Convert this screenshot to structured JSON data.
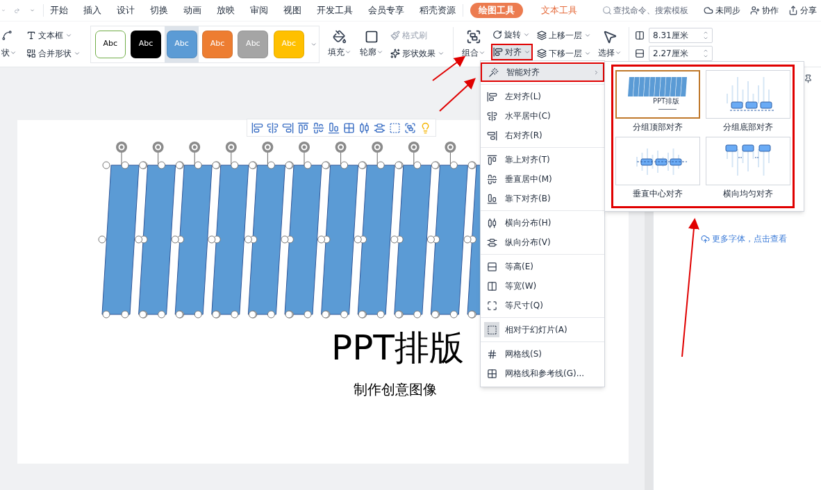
{
  "menu_tabs": [
    {
      "label": "开始",
      "selected": false
    },
    {
      "label": "插入",
      "selected": false
    },
    {
      "label": "设计",
      "selected": false
    },
    {
      "label": "切换",
      "selected": false
    },
    {
      "label": "动画",
      "selected": false
    },
    {
      "label": "放映",
      "selected": false
    },
    {
      "label": "审阅",
      "selected": false
    },
    {
      "label": "视图",
      "selected": false
    },
    {
      "label": "开发工具",
      "selected": false
    },
    {
      "label": "会员专享",
      "selected": false
    },
    {
      "label": "稻壳资源",
      "selected": false
    }
  ],
  "context_tabs": [
    {
      "label": "绘图工具",
      "selected": true
    },
    {
      "label": "文本工具",
      "selected": false
    }
  ],
  "search": {
    "placeholder": "查找命令、搜索模板"
  },
  "top_actions": [
    "未同步",
    "协作",
    "分享"
  ],
  "ribbon": {
    "shape_partial": "状",
    "textbox": "文本框",
    "merge_shapes": "合并形状",
    "style_presets": [
      {
        "label": "Abc",
        "color": "#ffffff",
        "selected": false
      },
      {
        "label": "Abc",
        "color": "#000000",
        "selected": false
      },
      {
        "label": "Abc",
        "color": "#5b9bd5",
        "selected": true
      },
      {
        "label": "Abc",
        "color": "#ed7d31",
        "selected": false
      },
      {
        "label": "Abc",
        "color": "#a5a5a5",
        "selected": false
      },
      {
        "label": "Abc",
        "color": "#ffc000",
        "selected": false
      }
    ],
    "fill": "填充",
    "outline": "轮廓",
    "format_painter": {
      "label": "格式刷",
      "disabled": true
    },
    "shape_effects": "形状效果",
    "group": "组合",
    "rotate": "旋转",
    "align": "对齐",
    "bring_forward": "上移一层",
    "send_backward": "下移一层",
    "select": "选择",
    "height": "8.31厘米",
    "width": "2.27厘米"
  },
  "slide": {
    "title": "PPT排版",
    "subtitle": "制作创意图像"
  },
  "align_menu": {
    "groups": [
      [
        {
          "label": "智能对齐",
          "kind": "submenu",
          "selected": true
        }
      ],
      [
        {
          "label": "左对齐(L)",
          "kind": "command",
          "selected": false
        },
        {
          "label": "水平居中(C)",
          "kind": "command",
          "selected": false
        },
        {
          "label": "右对齐(R)",
          "kind": "command",
          "selected": false
        }
      ],
      [
        {
          "label": "靠上对齐(T)",
          "kind": "command",
          "selected": false
        },
        {
          "label": "垂直居中(M)",
          "kind": "command",
          "selected": false
        },
        {
          "label": "靠下对齐(B)",
          "kind": "command",
          "selected": false
        }
      ],
      [
        {
          "label": "横向分布(H)",
          "kind": "command",
          "selected": false
        },
        {
          "label": "纵向分布(V)",
          "kind": "command",
          "selected": false
        }
      ],
      [
        {
          "label": "等高(E)",
          "kind": "command",
          "selected": false
        },
        {
          "label": "等宽(W)",
          "kind": "command",
          "selected": false
        },
        {
          "label": "等尺寸(Q)",
          "kind": "command",
          "selected": false
        }
      ],
      [
        {
          "label": "相对于幻灯片(A)",
          "kind": "toggle",
          "selected": false,
          "checked": true
        }
      ],
      [
        {
          "label": "网格线(S)",
          "kind": "command",
          "selected": false
        },
        {
          "label": "网格线和参考线(G)...",
          "kind": "command",
          "selected": false
        }
      ]
    ]
  },
  "smart_align": [
    {
      "caption": "分组顶部对齐",
      "selected": true,
      "preview_title": "PPT排版"
    },
    {
      "caption": "分组底部对齐",
      "selected": false
    },
    {
      "caption": "垂直中心对齐",
      "selected": false
    },
    {
      "caption": "横向均匀对齐",
      "selected": false
    }
  ],
  "side_panel": {
    "link": "更多字体，点击查看"
  }
}
